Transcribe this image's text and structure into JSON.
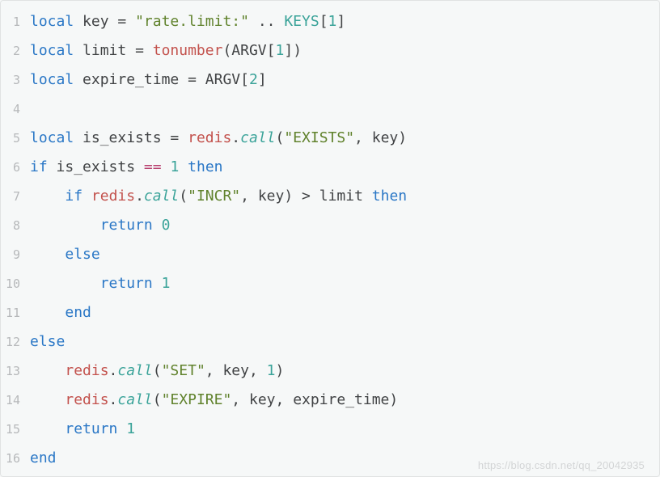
{
  "watermark": "https://blog.csdn.net/qq_20042935",
  "lines": [
    {
      "n": "1",
      "tokens": [
        {
          "t": "local",
          "c": "kw"
        },
        {
          "t": " ",
          "c": "sp"
        },
        {
          "t": "key",
          "c": "id"
        },
        {
          "t": " ",
          "c": "sp"
        },
        {
          "t": "=",
          "c": "op"
        },
        {
          "t": " ",
          "c": "sp"
        },
        {
          "t": "\"rate.limit:\"",
          "c": "str"
        },
        {
          "t": " ",
          "c": "sp"
        },
        {
          "t": "..",
          "c": "op"
        },
        {
          "t": " ",
          "c": "sp"
        },
        {
          "t": "KEYS",
          "c": "keysg"
        },
        {
          "t": "[",
          "c": "bracket"
        },
        {
          "t": "1",
          "c": "num"
        },
        {
          "t": "]",
          "c": "bracket"
        }
      ]
    },
    {
      "n": "2",
      "tokens": [
        {
          "t": "local",
          "c": "kw"
        },
        {
          "t": " ",
          "c": "sp"
        },
        {
          "t": "limit",
          "c": "id"
        },
        {
          "t": " ",
          "c": "sp"
        },
        {
          "t": "=",
          "c": "op"
        },
        {
          "t": " ",
          "c": "sp"
        },
        {
          "t": "tonumber",
          "c": "call1"
        },
        {
          "t": "(",
          "c": "bracket"
        },
        {
          "t": "ARGV",
          "c": "global"
        },
        {
          "t": "[",
          "c": "bracket"
        },
        {
          "t": "1",
          "c": "num"
        },
        {
          "t": "]",
          "c": "bracket"
        },
        {
          "t": ")",
          "c": "bracket"
        }
      ]
    },
    {
      "n": "3",
      "tokens": [
        {
          "t": "local",
          "c": "kw"
        },
        {
          "t": " ",
          "c": "sp"
        },
        {
          "t": "expire_time",
          "c": "id"
        },
        {
          "t": " ",
          "c": "sp"
        },
        {
          "t": "=",
          "c": "op"
        },
        {
          "t": " ",
          "c": "sp"
        },
        {
          "t": "ARGV",
          "c": "global"
        },
        {
          "t": "[",
          "c": "bracket"
        },
        {
          "t": "2",
          "c": "num"
        },
        {
          "t": "]",
          "c": "bracket"
        }
      ]
    },
    {
      "n": "4",
      "tokens": []
    },
    {
      "n": "5",
      "tokens": [
        {
          "t": "local",
          "c": "kw"
        },
        {
          "t": " ",
          "c": "sp"
        },
        {
          "t": "is_exists",
          "c": "id"
        },
        {
          "t": " ",
          "c": "sp"
        },
        {
          "t": "=",
          "c": "op"
        },
        {
          "t": " ",
          "c": "sp"
        },
        {
          "t": "redis",
          "c": "call1"
        },
        {
          "t": ".",
          "c": "op"
        },
        {
          "t": "call",
          "c": "call2"
        },
        {
          "t": "(",
          "c": "bracket"
        },
        {
          "t": "\"EXISTS\"",
          "c": "str"
        },
        {
          "t": ", ",
          "c": "op"
        },
        {
          "t": "key",
          "c": "id"
        },
        {
          "t": ")",
          "c": "bracket"
        }
      ]
    },
    {
      "n": "6",
      "tokens": [
        {
          "t": "if",
          "c": "kw"
        },
        {
          "t": " ",
          "c": "sp"
        },
        {
          "t": "is_exists",
          "c": "id"
        },
        {
          "t": " ",
          "c": "sp"
        },
        {
          "t": "==",
          "c": "eqop"
        },
        {
          "t": " ",
          "c": "sp"
        },
        {
          "t": "1",
          "c": "num"
        },
        {
          "t": " ",
          "c": "sp"
        },
        {
          "t": "then",
          "c": "kw"
        }
      ]
    },
    {
      "n": "7",
      "tokens": [
        {
          "t": "    ",
          "c": "sp"
        },
        {
          "t": "if",
          "c": "kw"
        },
        {
          "t": " ",
          "c": "sp"
        },
        {
          "t": "redis",
          "c": "call1"
        },
        {
          "t": ".",
          "c": "op"
        },
        {
          "t": "call",
          "c": "call2"
        },
        {
          "t": "(",
          "c": "bracket"
        },
        {
          "t": "\"INCR\"",
          "c": "str"
        },
        {
          "t": ", ",
          "c": "op"
        },
        {
          "t": "key",
          "c": "id"
        },
        {
          "t": ")",
          "c": "bracket"
        },
        {
          "t": " ",
          "c": "sp"
        },
        {
          "t": ">",
          "c": "op"
        },
        {
          "t": " ",
          "c": "sp"
        },
        {
          "t": "limit",
          "c": "id"
        },
        {
          "t": " ",
          "c": "sp"
        },
        {
          "t": "then",
          "c": "kw"
        }
      ]
    },
    {
      "n": "8",
      "tokens": [
        {
          "t": "        ",
          "c": "sp"
        },
        {
          "t": "return",
          "c": "kw"
        },
        {
          "t": " ",
          "c": "sp"
        },
        {
          "t": "0",
          "c": "num"
        }
      ]
    },
    {
      "n": "9",
      "tokens": [
        {
          "t": "    ",
          "c": "sp"
        },
        {
          "t": "else",
          "c": "kw"
        }
      ]
    },
    {
      "n": "10",
      "tokens": [
        {
          "t": "        ",
          "c": "sp"
        },
        {
          "t": "return",
          "c": "kw"
        },
        {
          "t": " ",
          "c": "sp"
        },
        {
          "t": "1",
          "c": "num"
        }
      ]
    },
    {
      "n": "11",
      "tokens": [
        {
          "t": "    ",
          "c": "sp"
        },
        {
          "t": "end",
          "c": "kw"
        }
      ]
    },
    {
      "n": "12",
      "tokens": [
        {
          "t": "else",
          "c": "kw"
        }
      ]
    },
    {
      "n": "13",
      "tokens": [
        {
          "t": "    ",
          "c": "sp"
        },
        {
          "t": "redis",
          "c": "call1"
        },
        {
          "t": ".",
          "c": "op"
        },
        {
          "t": "call",
          "c": "call2"
        },
        {
          "t": "(",
          "c": "bracket"
        },
        {
          "t": "\"SET\"",
          "c": "str"
        },
        {
          "t": ", ",
          "c": "op"
        },
        {
          "t": "key",
          "c": "id"
        },
        {
          "t": ", ",
          "c": "op"
        },
        {
          "t": "1",
          "c": "num"
        },
        {
          "t": ")",
          "c": "bracket"
        }
      ]
    },
    {
      "n": "14",
      "tokens": [
        {
          "t": "    ",
          "c": "sp"
        },
        {
          "t": "redis",
          "c": "call1"
        },
        {
          "t": ".",
          "c": "op"
        },
        {
          "t": "call",
          "c": "call2"
        },
        {
          "t": "(",
          "c": "bracket"
        },
        {
          "t": "\"EXPIRE\"",
          "c": "str"
        },
        {
          "t": ", ",
          "c": "op"
        },
        {
          "t": "key",
          "c": "id"
        },
        {
          "t": ", ",
          "c": "op"
        },
        {
          "t": "expire_time",
          "c": "id"
        },
        {
          "t": ")",
          "c": "bracket"
        }
      ]
    },
    {
      "n": "15",
      "tokens": [
        {
          "t": "    ",
          "c": "sp"
        },
        {
          "t": "return",
          "c": "kw"
        },
        {
          "t": " ",
          "c": "sp"
        },
        {
          "t": "1",
          "c": "num"
        }
      ]
    },
    {
      "n": "16",
      "tokens": [
        {
          "t": "end",
          "c": "kw"
        }
      ]
    }
  ]
}
